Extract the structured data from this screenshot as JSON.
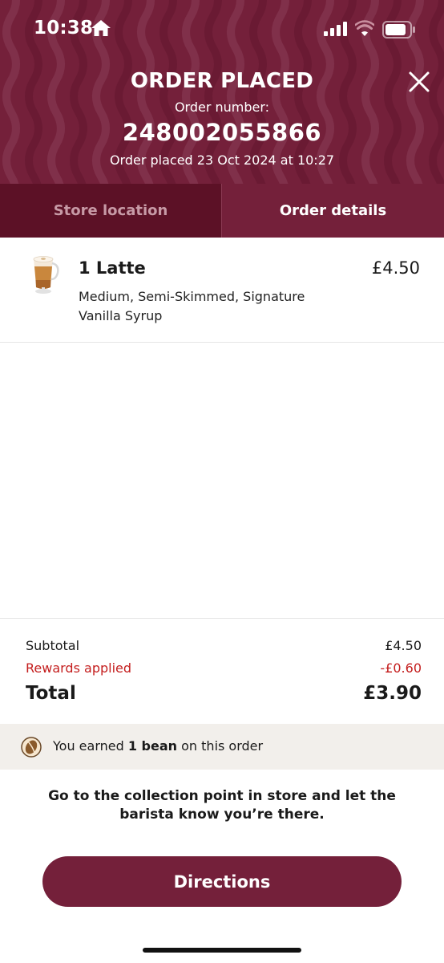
{
  "status_bar": {
    "time": "10:38"
  },
  "header": {
    "title": "ORDER PLACED",
    "order_number_label": "Order number:",
    "order_number": "248002055866",
    "placed_at": "Order placed 23 Oct 2024 at 10:27",
    "close_icon": "close-icon"
  },
  "tabs": [
    {
      "label": "Store location",
      "active": false
    },
    {
      "label": "Order details",
      "active": true
    }
  ],
  "items": [
    {
      "name": "1 Latte",
      "description": "Medium, Semi-Skimmed, Signature Vanilla Syrup",
      "price": "£4.50",
      "icon": "latte-image"
    }
  ],
  "summary": {
    "subtotal_label": "Subtotal",
    "subtotal_value": "£4.50",
    "rewards_label": "Rewards applied",
    "rewards_value": "-£0.60",
    "total_label": "Total",
    "total_value": "£3.90"
  },
  "rewards": {
    "prefix": "You earned ",
    "bold": "1 bean",
    "suffix": " on this order",
    "icon": "coffee-bean-icon"
  },
  "instruction": "Go to the collection point in store and let the barista know you’re there.",
  "button": {
    "label": "Directions"
  },
  "colors": {
    "brand": "#74203a",
    "brand_dark": "#5c1126",
    "discount": "#c41e1e",
    "bean_bar_bg": "#f2efeb"
  }
}
